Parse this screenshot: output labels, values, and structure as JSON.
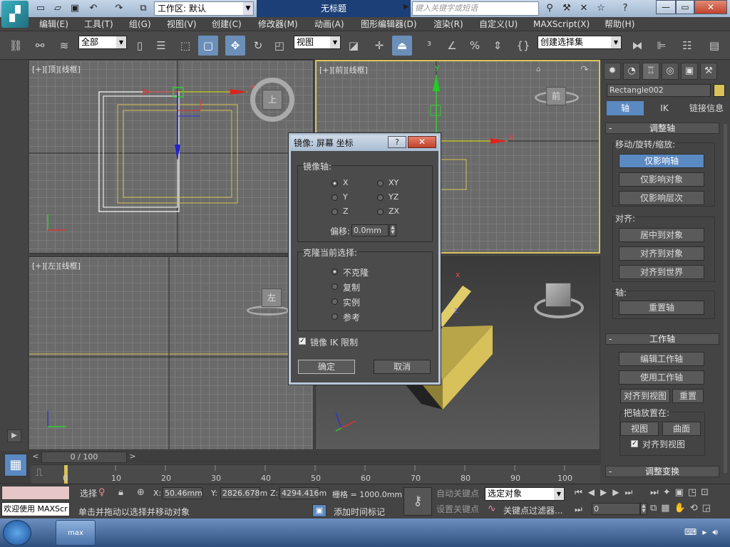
{
  "titlebar": {
    "workspace_label": "工作区: 默认",
    "doc_title": "无标题",
    "search_placeholder": "键入关键字或短语",
    "min": "—",
    "max": "▭",
    "close": "✕"
  },
  "menu": [
    "编辑(E)",
    "工具(T)",
    "组(G)",
    "视图(V)",
    "创建(C)",
    "修改器(M)",
    "动画(A)",
    "图形编辑器(D)",
    "渲染(R)",
    "自定义(U)",
    "MAXScript(X)",
    "帮助(H)"
  ],
  "toolbar": {
    "filter_value": "全部",
    "ref_coord_value": "视图",
    "selection_set_value": "创建选择集"
  },
  "viewports": {
    "top_label": "[+][顶][线框]",
    "front_label": "[+][前][线框]",
    "left_label": "[+][左][线框]",
    "viewcube_top": "上",
    "viewcube_front": "前",
    "viewcube_left": "左",
    "axis_x": "x",
    "axis_y": "y",
    "axis_z": "z"
  },
  "command_panel": {
    "object_name": "Rectangle002",
    "tabs": [
      "轴",
      "IK",
      "链接信息"
    ],
    "rollout_adjust_pivot": "调整轴",
    "move_rotate_scale": "移动/旋转/缩放:",
    "btn_affect_pivot": "仅影响轴",
    "btn_affect_object": "仅影响对象",
    "btn_affect_hierarchy": "仅影响层次",
    "align_label": "对齐:",
    "btn_center_to_object": "居中到对象",
    "btn_align_to_object": "对齐到对象",
    "btn_align_to_world": "对齐到世界",
    "pivot_label": "轴:",
    "btn_reset_pivot": "重置轴",
    "rollout_working_pivot": "工作轴",
    "btn_edit_working_pivot": "编辑工作轴",
    "btn_use_working_pivot": "使用工作轴",
    "btn_align_to_view": "对齐到视图",
    "btn_reset": "重置",
    "place_pivot_label": "把轴放置在:",
    "btn_view": "视图",
    "btn_surface": "曲面",
    "chk_align_to_view": "对齐到视图",
    "rollout_adjust_transform": "调整变换"
  },
  "dialog": {
    "title": "镜像: 屏幕 坐标",
    "help": "?",
    "close": "✕",
    "mirror_axis_label": "镜像轴:",
    "axes": [
      "X",
      "Y",
      "Z",
      "XY",
      "YZ",
      "ZX"
    ],
    "selected_axis": "X",
    "offset_label": "偏移:",
    "offset_value": "0.0mm",
    "clone_label": "克隆当前选择:",
    "clone_options": [
      "不克隆",
      "复制",
      "实例",
      "参考"
    ],
    "selected_clone": "不克隆",
    "mirror_ik_label": "镜像 IK 限制",
    "mirror_ik_checked": true,
    "ok": "确定",
    "cancel": "取消"
  },
  "timeline": {
    "frame_display": "0 / 100",
    "prev": "<",
    "next": ">",
    "ticks": [
      "0",
      "10",
      "20",
      "30",
      "40",
      "50",
      "60",
      "70",
      "80",
      "90",
      "100"
    ]
  },
  "status": {
    "maxscript_listener": "欢迎使用 MAXScr",
    "selection_label": "选择",
    "x_label": "X:",
    "x_value": "50.46mm",
    "y_label": "Y:",
    "y_value": "2826.678m",
    "z_label": "Z:",
    "z_value": "4294.416m",
    "grid": "栅格 = 1000.0mm",
    "prompt": "单击并拖动以选择并移动对象",
    "add_time_tag": "添加时间标记",
    "auto_key": "自动关键点",
    "set_key": "设置关键点",
    "key_mode_value": "选定对象",
    "key_filters": "关键点过滤器...",
    "frame_value": "0"
  },
  "taskbar": {
    "app_label": "max"
  }
}
